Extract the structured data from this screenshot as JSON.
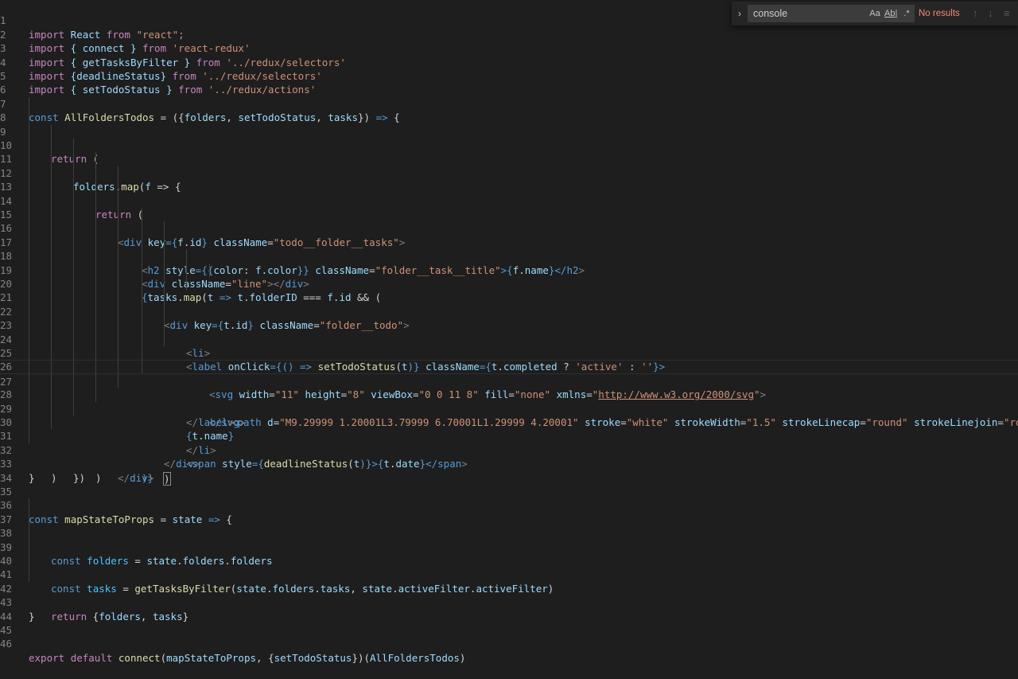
{
  "find": {
    "toggle_glyph": "›",
    "query": "console",
    "match_case": "Aa",
    "whole_word": "Ab|",
    "regex": ".*",
    "status": "No results",
    "prev": "↑",
    "next": "↓",
    "menu": "≡"
  },
  "line_numbers": [
    "1",
    "2",
    "3",
    "4",
    "5",
    "6",
    "7",
    "8",
    "9",
    "10",
    "11",
    "12",
    "13",
    "14",
    "15",
    "16",
    "17",
    "18",
    "19",
    "20",
    "21",
    "22",
    "23",
    "24",
    "25",
    "26",
    "27",
    "28",
    "29",
    "30",
    "31",
    "32",
    "33",
    "34",
    "35",
    "36",
    "37",
    "38",
    "39",
    "40",
    "41",
    "42",
    "43",
    "44",
    "45",
    "46"
  ],
  "code": {
    "l1": [
      "import",
      " React ",
      "from",
      " \"react\";"
    ],
    "l2": [
      "import",
      " { connect } ",
      "from",
      " 'react-redux'"
    ],
    "l3": [
      "import",
      " { getTasksByFilter } ",
      "from",
      " '../redux/selectors'"
    ],
    "l4": [
      "import",
      " {deadlineStatus} ",
      "from",
      " '../redux/selectors'"
    ],
    "l5": [
      "import",
      " { setTodoStatus } ",
      "from",
      " '../redux/actions'"
    ],
    "l7": [
      "const",
      " AllFoldersTodos",
      " = ({",
      "folders",
      ", ",
      "setTodoStatus",
      ", ",
      "tasks",
      "}) ",
      "=>",
      " {"
    ],
    "l9": [
      "return",
      " ("
    ],
    "l10": [
      "folders",
      ".",
      "map",
      "(",
      "f",
      " => {"
    ],
    "l11": [
      "return",
      " ("
    ],
    "l12": [
      "<",
      "div",
      " ",
      "key",
      "={",
      "f",
      ".",
      "id",
      "} ",
      "className",
      "=",
      "\"todo__folder__tasks\"",
      ">"
    ],
    "l13": [
      "<",
      "h2",
      " ",
      "style",
      "={{",
      "color",
      ": ",
      "f",
      ".",
      "color",
      "}} ",
      "className",
      "=",
      "\"folder__task__title\"",
      ">{",
      "f",
      ".",
      "name",
      "}</",
      "h2",
      ">"
    ],
    "l14": [
      "<",
      "div",
      " ",
      "className",
      "=",
      "\"line\"",
      "></",
      "div",
      ">"
    ],
    "l15": [
      "{",
      "tasks",
      ".",
      "map",
      "(",
      "t",
      " => ",
      "t",
      ".",
      "folderID",
      " === ",
      "f",
      ".",
      "id",
      " && ("
    ],
    "l16": [
      "<",
      "div",
      " ",
      "key",
      "={",
      "t",
      ".",
      "id",
      "} ",
      "className",
      "=",
      "\"folder__todo\"",
      ">"
    ],
    "l17": [
      "<",
      "li",
      ">"
    ],
    "l18": [
      "<",
      "label",
      " ",
      "onClick",
      "={() => ",
      "setTodoStatus",
      "(",
      "t",
      ")} ",
      "className",
      "={",
      "t",
      ".",
      "completed",
      " ? ",
      "'active'",
      " : ",
      "''",
      "}>"
    ],
    "l19": [
      "<",
      "svg",
      " ",
      "width",
      "=",
      "\"11\"",
      " ",
      "height",
      "=",
      "\"8\"",
      " ",
      "viewBox",
      "=",
      "\"0 0 11 8\"",
      " ",
      "fill",
      "=",
      "\"none\"",
      " ",
      "xmlns",
      "=",
      "\"",
      "http://www.w3.org/2000/svg",
      "\"",
      ">"
    ],
    "l20": [
      "<",
      "path",
      " ",
      "d",
      "=",
      "\"M9.29999 1.20001L3.79999 6.70001L1.29999 4.20001\"",
      " ",
      "stroke",
      "=",
      "\"white\"",
      " ",
      "strokeWidth",
      "=",
      "\"1.5\"",
      " ",
      "strokeLinecap",
      "=",
      "\"round\"",
      " ",
      "strokeLinejoin",
      "=",
      "\"round\"",
      "/>"
    ],
    "l21": [
      "</",
      "svg",
      ">"
    ],
    "l22": [
      "</",
      "label",
      ">"
    ],
    "l23": [
      "{",
      "t",
      ".",
      "name",
      "}"
    ],
    "l24": [
      "</",
      "li",
      ">"
    ],
    "l25": [
      "<",
      "span",
      " ",
      "style",
      "={",
      "deadlineStatus",
      "(",
      "t",
      ")}>{",
      "t",
      ".",
      "date",
      "}</",
      "span",
      ">"
    ],
    "l26": [
      "</",
      "div",
      ">"
    ],
    "l27": [
      ")"
    ],
    "l28": [
      ")}"
    ],
    "l29": [
      "</",
      "div",
      ">"
    ],
    "l30": [
      ")"
    ],
    "l31": [
      "})"
    ],
    "l32": [
      ")"
    ],
    "l33": [
      "}"
    ],
    "l36": [
      "const",
      " mapStateToProps",
      " = ",
      "state",
      " ",
      "=>",
      " {"
    ],
    "l38": [
      "const",
      " folders",
      " = ",
      "state",
      ".",
      "folders",
      ".",
      "folders"
    ],
    "l40": [
      "const",
      " tasks",
      " = ",
      "getTasksByFilter",
      "(",
      "state",
      ".",
      "folders",
      ".",
      "tasks",
      ", ",
      "state",
      ".",
      "activeFilter",
      ".",
      "activeFilter",
      ")"
    ],
    "l42": [
      "return",
      " {",
      "folders",
      ", ",
      "tasks",
      "}"
    ],
    "l43": [
      "}"
    ],
    "l46": [
      "export",
      " ",
      "default",
      " ",
      "connect",
      "(",
      "mapStateToProps",
      ", {",
      "setTodoStatus",
      "})(",
      "AllFoldersTodos",
      ")"
    ]
  }
}
